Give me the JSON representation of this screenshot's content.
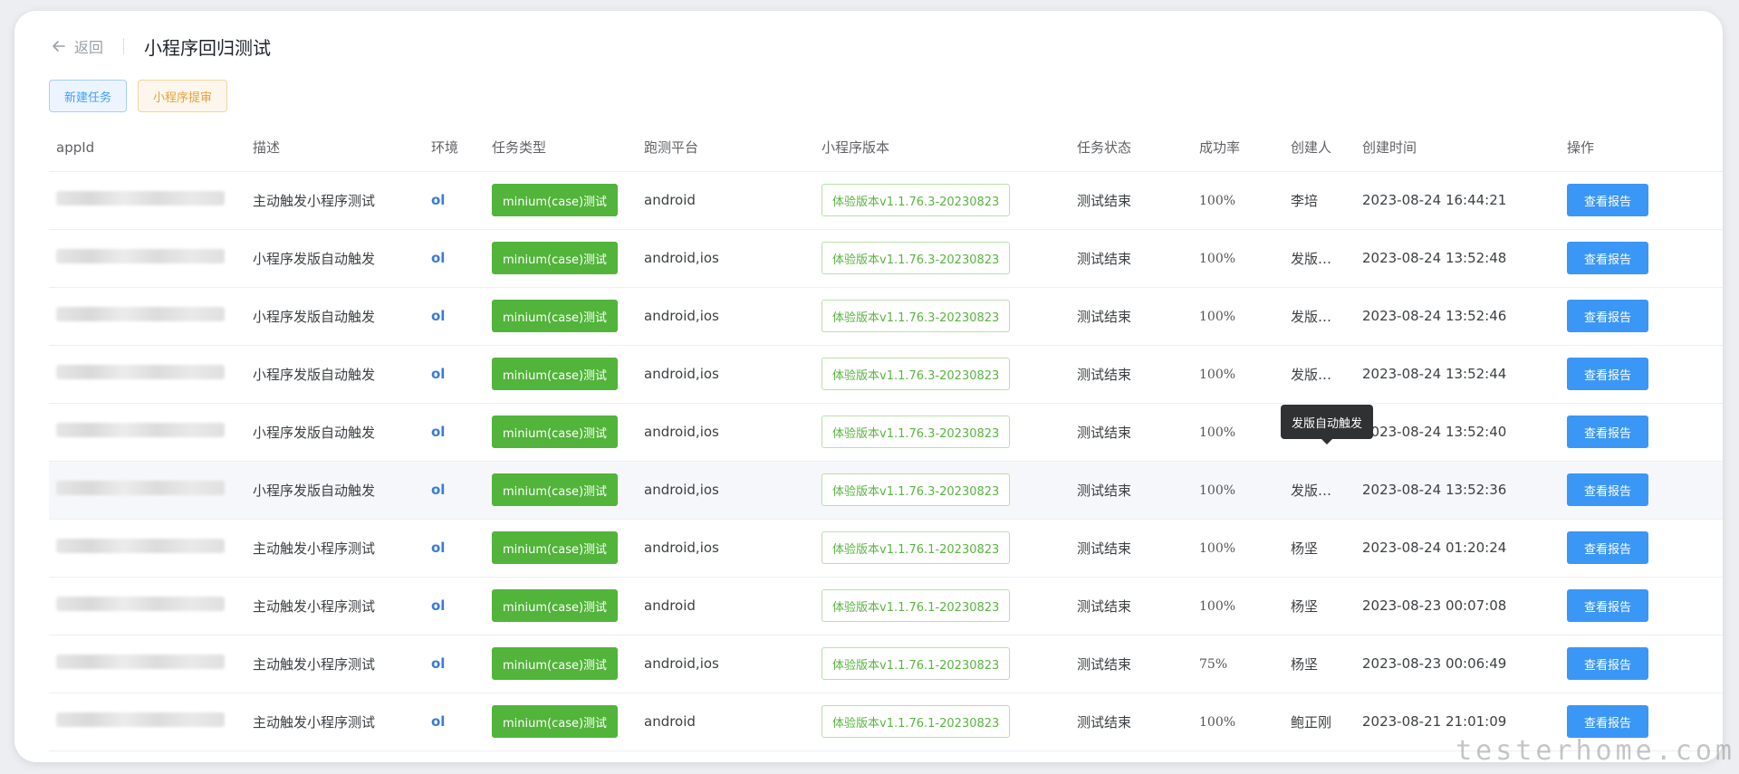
{
  "header": {
    "back_label": "返回",
    "title": "小程序回归测试"
  },
  "actions": {
    "new_task": "新建任务",
    "submit_review": "小程序提审"
  },
  "table": {
    "columns": [
      "appId",
      "描述",
      "环境",
      "任务类型",
      "跑测平台",
      "小程序版本",
      "任务状态",
      "成功率",
      "创建人",
      "创建时间",
      "操作"
    ],
    "rows": [
      {
        "desc": "主动触发小程序测试",
        "env": "ol",
        "type": "minium(case)测试",
        "platform": "android",
        "version": "体验版本v1.1.76.3-20230823",
        "status": "测试结束",
        "rate": "100%",
        "creator": "李培",
        "time": "2023-08-24 16:44:21",
        "action": "查看报告"
      },
      {
        "desc": "小程序发版自动触发",
        "env": "ol",
        "type": "minium(case)测试",
        "platform": "android,ios",
        "version": "体验版本v1.1.76.3-20230823",
        "status": "测试结束",
        "rate": "100%",
        "creator": "发版…",
        "time": "2023-08-24 13:52:48",
        "action": "查看报告"
      },
      {
        "desc": "小程序发版自动触发",
        "env": "ol",
        "type": "minium(case)测试",
        "platform": "android,ios",
        "version": "体验版本v1.1.76.3-20230823",
        "status": "测试结束",
        "rate": "100%",
        "creator": "发版…",
        "time": "2023-08-24 13:52:46",
        "action": "查看报告"
      },
      {
        "desc": "小程序发版自动触发",
        "env": "ol",
        "type": "minium(case)测试",
        "platform": "android,ios",
        "version": "体验版本v1.1.76.3-20230823",
        "status": "测试结束",
        "rate": "100%",
        "creator": "发版…",
        "time": "2023-08-24 13:52:44",
        "action": "查看报告"
      },
      {
        "desc": "小程序发版自动触发",
        "env": "ol",
        "type": "minium(case)测试",
        "platform": "android,ios",
        "version": "体验版本v1.1.76.3-20230823",
        "status": "测试结束",
        "rate": "100%",
        "creator": "",
        "time": "2023-08-24 13:52:40",
        "action": "查看报告"
      },
      {
        "desc": "小程序发版自动触发",
        "env": "ol",
        "type": "minium(case)测试",
        "platform": "android,ios",
        "version": "体验版本v1.1.76.3-20230823",
        "status": "测试结束",
        "rate": "100%",
        "creator": "发版…",
        "time": "2023-08-24 13:52:36",
        "action": "查看报告"
      },
      {
        "desc": "主动触发小程序测试",
        "env": "ol",
        "type": "minium(case)测试",
        "platform": "android,ios",
        "version": "体验版本v1.1.76.1-20230823",
        "status": "测试结束",
        "rate": "100%",
        "creator": "杨坚",
        "time": "2023-08-24 01:20:24",
        "action": "查看报告"
      },
      {
        "desc": "主动触发小程序测试",
        "env": "ol",
        "type": "minium(case)测试",
        "platform": "android",
        "version": "体验版本v1.1.76.1-20230823",
        "status": "测试结束",
        "rate": "100%",
        "creator": "杨坚",
        "time": "2023-08-23 00:07:08",
        "action": "查看报告"
      },
      {
        "desc": "主动触发小程序测试",
        "env": "ol",
        "type": "minium(case)测试",
        "platform": "android,ios",
        "version": "体验版本v1.1.76.1-20230823",
        "status": "测试结束",
        "rate": "75%",
        "creator": "杨坚",
        "time": "2023-08-23 00:06:49",
        "action": "查看报告"
      },
      {
        "desc": "主动触发小程序测试",
        "env": "ol",
        "type": "minium(case)测试",
        "platform": "android",
        "version": "体验版本v1.1.76.1-20230823",
        "status": "测试结束",
        "rate": "100%",
        "creator": "鲍正刚",
        "time": "2023-08-21 21:01:09",
        "action": "查看报告"
      }
    ]
  },
  "tooltip": "发版自动触发",
  "watermark": "testerhome.com",
  "colors": {
    "primary": "#3b97f5",
    "success": "#52b43a",
    "warning": "#e6a23c"
  }
}
